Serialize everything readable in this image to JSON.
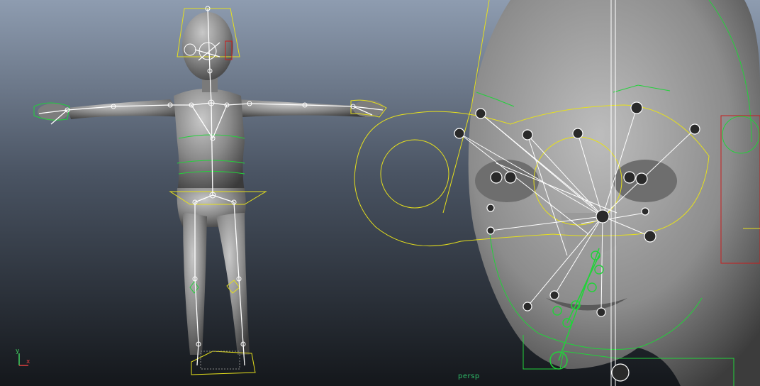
{
  "viewport": {
    "camera_label": "persp",
    "axis_x_label": "x",
    "axis_y_label": "y"
  },
  "colors": {
    "bg_top": "#8f9db0",
    "bg_bottom": "#15181c",
    "joint": "#ffffff",
    "control_yellow": "#e6e01c",
    "control_green": "#22d23a",
    "control_red": "#c81e1e",
    "mesh": "#8a8a8a"
  },
  "icons": [
    "axis-gizmo-icon"
  ]
}
